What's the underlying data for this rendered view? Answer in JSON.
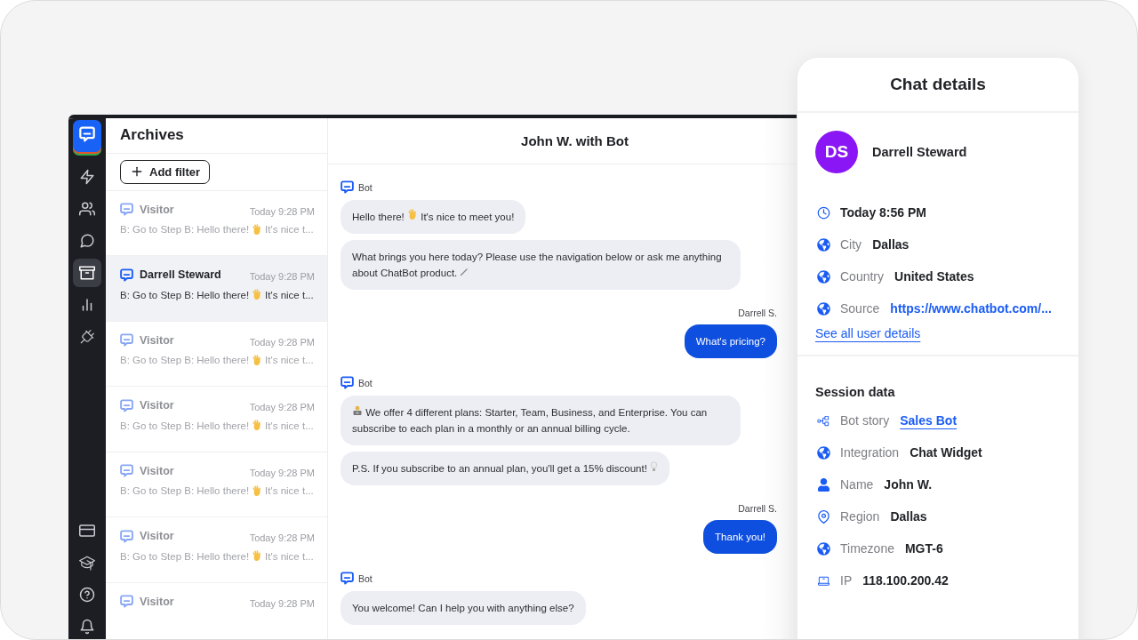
{
  "nav": {
    "items": [
      {
        "selected": false
      },
      {
        "selected": false
      },
      {
        "selected": false
      },
      {
        "selected": true
      },
      {
        "selected": false
      },
      {
        "selected": false
      }
    ],
    "bottom_items": [
      {
        "selected": false
      },
      {
        "selected": false
      },
      {
        "selected": false
      },
      {
        "selected": false
      }
    ]
  },
  "archives": {
    "title": "Archives",
    "filter_button": "Add filter",
    "items": [
      {
        "name": "Visitor",
        "time": "Today 9:28 PM",
        "preview": "B: Go to Step B: Hello there!",
        "preview_after": "It's nice t...",
        "selected": false
      },
      {
        "name": "Darrell Steward",
        "time": "Today 9:28 PM",
        "preview": "B: Go to Step B: Hello there!",
        "preview_after": "It's nice t...",
        "selected": true
      },
      {
        "name": "Visitor",
        "time": "Today 9:28 PM",
        "preview": "B: Go to Step B: Hello there!",
        "preview_after": "It's nice t...",
        "selected": false
      },
      {
        "name": "Visitor",
        "time": "Today 9:28 PM",
        "preview": "B: Go to Step B: Hello there!",
        "preview_after": "It's nice t...",
        "selected": false
      },
      {
        "name": "Visitor",
        "time": "Today 9:28 PM",
        "preview": "B: Go to Step B: Hello there!",
        "preview_after": "It's nice t...",
        "selected": false
      },
      {
        "name": "Visitor",
        "time": "Today 9:28 PM",
        "preview": "B: Go to Step B: Hello there!",
        "preview_after": "It's nice t...",
        "selected": false
      },
      {
        "name": "Visitor",
        "time": "Today 9:28 PM",
        "selected": false
      }
    ]
  },
  "chat": {
    "title": "John W. with Bot",
    "groups": [
      {
        "kind": "bot",
        "sender": "Bot",
        "bubbles": [
          {
            "kind": "emoji",
            "text": "Hello there!",
            "text_after": "It's nice to meet you!"
          },
          {
            "kind": "emoji",
            "text": "What brings you here today? Please use the navigation below or ask me anything about ChatBot product."
          }
        ]
      },
      {
        "kind": "user",
        "sender": "Darrell S.",
        "bubbles": [
          {
            "text": "What's pricing?"
          }
        ]
      },
      {
        "kind": "bot",
        "sender": "Bot",
        "bubbles": [
          {
            "kind": "emoji",
            "text_after": "We offer 4 different plans: Starter, Team, Business, and Enterprise. You can subscribe to each plan in a monthly or an annual billing cycle."
          },
          {
            "kind": "emoji",
            "text": "P.S. If you subscribe to an annual plan, you'll get a 15% discount!"
          }
        ]
      },
      {
        "kind": "user",
        "sender": "Darrell S.",
        "bubbles": [
          {
            "text": "Thank you!"
          }
        ]
      },
      {
        "kind": "bot",
        "sender": "Bot",
        "bubbles": [
          {
            "text": "You welcome! Can I help you with anything else?"
          }
        ]
      }
    ]
  },
  "details": {
    "title": "Chat details",
    "user": {
      "initials": "DS",
      "name": "Darrell Steward"
    },
    "rows": [
      {
        "kind": "clock",
        "value": "Today 8:56 PM"
      },
      {
        "kind": "globe",
        "label": "City",
        "value": "Dallas"
      },
      {
        "kind": "globe",
        "label": "Country",
        "value": "United States"
      },
      {
        "kind": "globe",
        "label": "Source",
        "value": "https://www.chatbot.com/...",
        "link": true
      }
    ],
    "see_all": "See all user details",
    "session_title": "Session data",
    "session_rows": [
      {
        "kind": "tree",
        "label": "Bot story",
        "value": "Sales Bot",
        "link": true,
        "underline": true
      },
      {
        "kind": "globe",
        "label": "Integration",
        "value": "Chat Widget"
      },
      {
        "kind": "user",
        "label": "Name",
        "value": "John W."
      },
      {
        "kind": "pin",
        "label": "Region",
        "value": "Dallas"
      },
      {
        "kind": "globe",
        "label": "Timezone",
        "value": "MGT-6"
      },
      {
        "kind": "laptop",
        "label": "IP",
        "value": "118.100.200.42"
      }
    ]
  }
}
